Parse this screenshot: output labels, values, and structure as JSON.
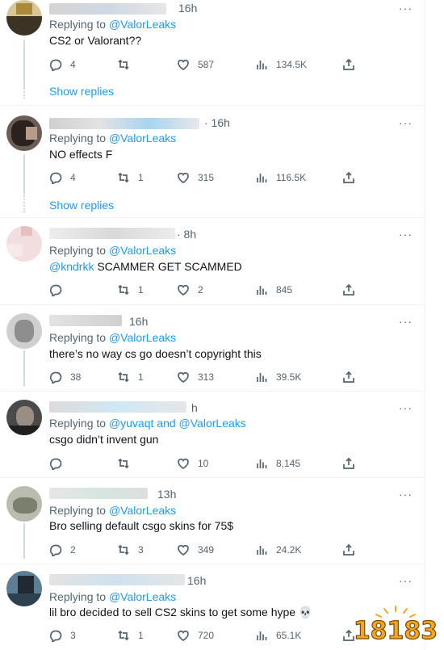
{
  "tweets": [
    {
      "time": "16h",
      "replying_prefix": "Replying to",
      "replying_to": "@ValorLeaks",
      "replying_and": "",
      "replying_to2": "",
      "text_mention": "",
      "text": "CS2 or Valorant??",
      "replies": "4",
      "retweets": "",
      "likes": "587",
      "views": "134.5K",
      "show_replies": "Show replies"
    },
    {
      "time": "· 16h",
      "replying_prefix": "Replying to",
      "replying_to": "@ValorLeaks",
      "replying_and": "",
      "replying_to2": "",
      "text_mention": "",
      "text": "NO effects F",
      "replies": "4",
      "retweets": "1",
      "likes": "315",
      "views": "116.5K",
      "show_replies": "Show replies"
    },
    {
      "time": "· 8h",
      "replying_prefix": "Replying to",
      "replying_to": "@ValorLeaks",
      "replying_and": "",
      "replying_to2": "",
      "text_mention": "@kndrkk",
      "text": " SCAMMER GET SCAMMED",
      "replies": "",
      "retweets": "1",
      "likes": "2",
      "views": "845",
      "show_replies": ""
    },
    {
      "time": "16h",
      "replying_prefix": "Replying to",
      "replying_to": "@ValorLeaks",
      "replying_and": "",
      "replying_to2": "",
      "text_mention": "",
      "text": "there’s no way cs go doesn’t copyright this",
      "replies": "38",
      "retweets": "1",
      "likes": "313",
      "views": "39.5K",
      "show_replies": ""
    },
    {
      "time": "h",
      "replying_prefix": "Replying to",
      "replying_to": "@yuvaqt",
      "replying_and": "and",
      "replying_to2": "@ValorLeaks",
      "text_mention": "",
      "text": "csgo didn’t invent gun",
      "replies": "",
      "retweets": "",
      "likes": "10",
      "views": "8,145",
      "show_replies": ""
    },
    {
      "time": "13h",
      "replying_prefix": "Replying to",
      "replying_to": "@ValorLeaks",
      "replying_and": "",
      "replying_to2": "",
      "text_mention": "",
      "text": "Bro selling default csgo skins for 75$",
      "replies": "2",
      "retweets": "3",
      "likes": "349",
      "views": "24.2K",
      "show_replies": ""
    },
    {
      "time": "16h",
      "replying_prefix": "Replying to",
      "replying_to": "@ValorLeaks",
      "replying_and": "",
      "replying_to2": "",
      "text_mention": "",
      "text": "lil bro decided to sell CS2 skins to get some hype 💀",
      "replies": "3",
      "retweets": "1",
      "likes": "720",
      "views": "65.1K",
      "show_replies": ""
    }
  ],
  "more_label": "···",
  "watermark": "18183",
  "colors": {
    "accent": "#1d9bf0",
    "muted": "#536471",
    "text": "#0f1419",
    "divider": "#eff3f4"
  },
  "icons": [
    "reply-icon",
    "retweet-icon",
    "like-icon",
    "views-icon",
    "share-icon",
    "more-icon"
  ]
}
